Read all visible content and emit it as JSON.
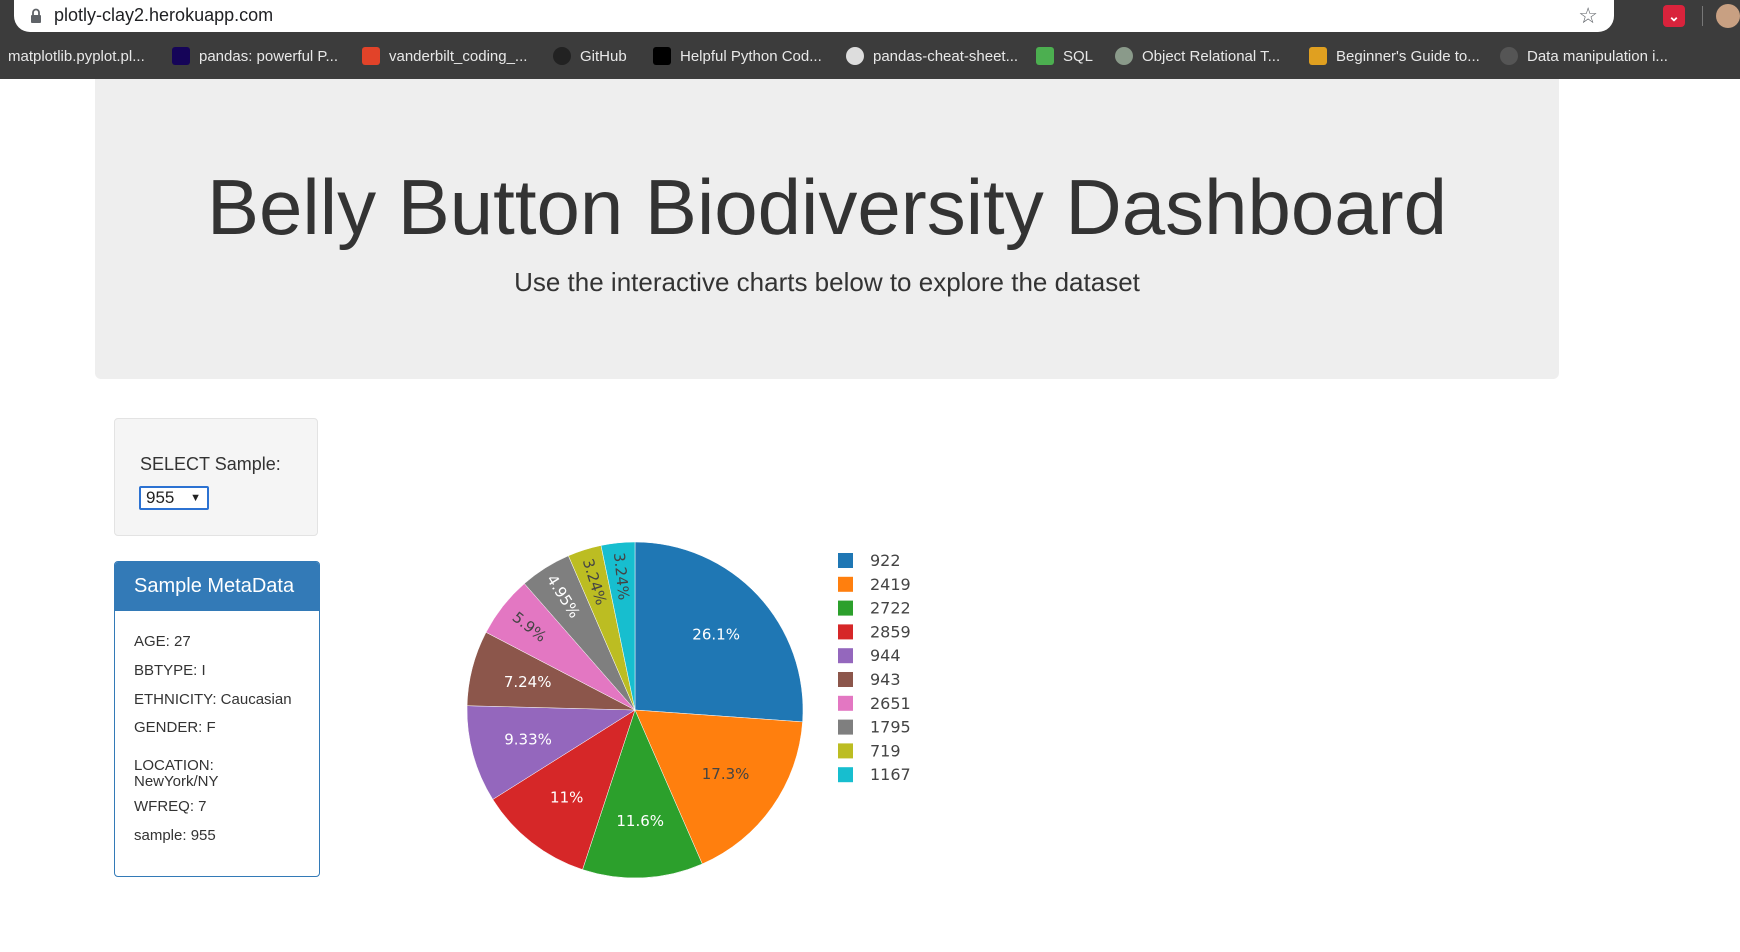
{
  "browser": {
    "url": "plotly-clay2.herokuapp.com",
    "bookmarks": [
      {
        "label": "matplotlib.pyplot.pl...",
        "icon": "none",
        "color": ""
      },
      {
        "label": "pandas: powerful P...",
        "icon": "pandas-icon",
        "color": "#150458"
      },
      {
        "label": "vanderbilt_coding_...",
        "icon": "gitlab-icon",
        "color": "#e24329"
      },
      {
        "label": "GitHub",
        "icon": "github-icon",
        "color": "#222222"
      },
      {
        "label": "Helpful Python Cod...",
        "icon": "medium-icon",
        "color": "#000000"
      },
      {
        "label": "pandas-cheat-sheet...",
        "icon": "globe-icon",
        "color": "#dddddd"
      },
      {
        "label": "SQL",
        "icon": "w3schools-icon",
        "color": "#4caf50"
      },
      {
        "label": "Object Relational T...",
        "icon": "circle-icon",
        "color": "#8a9a8a"
      },
      {
        "label": "Beginner's Guide to...",
        "icon": "c-icon",
        "color": "#e0a020"
      },
      {
        "label": "Data manipulation i...",
        "icon": "globe-icon",
        "color": "#555555"
      }
    ]
  },
  "header": {
    "title": "Belly Button Biodiversity Dashboard",
    "subtitle": "Use the interactive charts below to explore the dataset"
  },
  "selector": {
    "label": "SELECT Sample:",
    "value": "955"
  },
  "metadata": {
    "title": "Sample MetaData",
    "items": [
      "AGE: 27",
      "BBTYPE: I",
      "ETHNICITY: Caucasian",
      "GENDER: F",
      "LOCATION: NewYork/NY",
      "WFREQ: 7",
      "sample: 955"
    ]
  },
  "chart_data": {
    "type": "pie",
    "labels": [
      "922",
      "2419",
      "2722",
      "2859",
      "944",
      "943",
      "2651",
      "1795",
      "719",
      "1167"
    ],
    "values": [
      26.1,
      17.3,
      11.6,
      11,
      9.33,
      7.24,
      5.9,
      4.95,
      3.24,
      3.24
    ],
    "value_labels": [
      "26.1%",
      "17.3%",
      "11.6%",
      "11%",
      "9.33%",
      "7.24%",
      "5.9%",
      "4.95%",
      "3.24%",
      "3.24%"
    ],
    "colors": [
      "#1f77b4",
      "#ff7f0e",
      "#2ca02c",
      "#d62728",
      "#9467bd",
      "#8c564b",
      "#e377c2",
      "#7f7f7f",
      "#bcbd22",
      "#17becf"
    ],
    "slice_order": [
      0,
      1,
      2,
      3,
      4,
      5,
      6,
      7,
      8,
      9
    ],
    "legend_position": "right"
  }
}
